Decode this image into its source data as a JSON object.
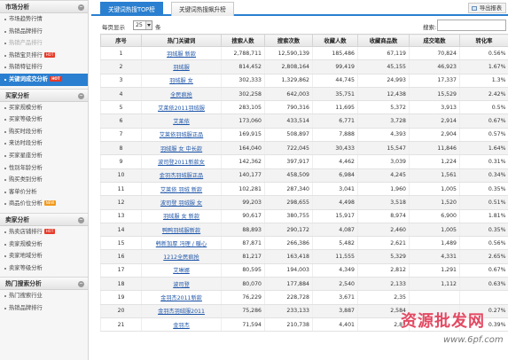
{
  "sidebar": {
    "sections": [
      {
        "title": "市场分析",
        "items": [
          {
            "label": "市场趋势行情",
            "style": "normal",
            "badge": ""
          },
          {
            "label": "热销品牌排行",
            "style": "normal",
            "badge": ""
          },
          {
            "label": "热销产品排行",
            "style": "gray",
            "badge": ""
          },
          {
            "label": "热销宝贝排行",
            "style": "normal",
            "badge": "HOT"
          },
          {
            "label": "热销特征排行",
            "style": "normal",
            "badge": ""
          },
          {
            "label": "关键词成交分析",
            "style": "active",
            "badge": "HOT"
          }
        ]
      },
      {
        "title": "买家分析",
        "items": [
          {
            "label": "买家规模分析",
            "style": "normal",
            "badge": ""
          },
          {
            "label": "买家等级分析",
            "style": "normal",
            "badge": ""
          },
          {
            "label": "购买时段分析",
            "style": "normal",
            "badge": ""
          },
          {
            "label": "来访时段分析",
            "style": "normal",
            "badge": ""
          },
          {
            "label": "买家星座分析",
            "style": "normal",
            "badge": ""
          },
          {
            "label": "性别年龄分析",
            "style": "normal",
            "badge": ""
          },
          {
            "label": "购买类别分析",
            "style": "normal",
            "badge": ""
          },
          {
            "label": "客单价分析",
            "style": "normal",
            "badge": ""
          },
          {
            "label": "商品价位分析",
            "style": "normal",
            "badge": "NEW"
          }
        ]
      },
      {
        "title": "卖家分析",
        "items": [
          {
            "label": "热卖店铺排行",
            "style": "normal",
            "badge": "HOT"
          },
          {
            "label": "卖家规模分析",
            "style": "normal",
            "badge": ""
          },
          {
            "label": "卖家地域分析",
            "style": "normal",
            "badge": ""
          },
          {
            "label": "卖家等级分析",
            "style": "normal",
            "badge": ""
          }
        ]
      },
      {
        "title": "热门搜索分析",
        "items": [
          {
            "label": "热门搜索行业",
            "style": "normal",
            "badge": ""
          },
          {
            "label": "热销品牌排行",
            "style": "normal",
            "badge": ""
          }
        ]
      }
    ]
  },
  "tabs": [
    {
      "label": "关键词热搜TOP榜",
      "active": true
    },
    {
      "label": "关键词热搜飙升榜",
      "active": false
    }
  ],
  "export_label": "导出报表",
  "toolbar": {
    "pagesize_prefix": "每页显示",
    "pagesize_value": "25",
    "pagesize_suffix": "条",
    "search_label": "搜索:",
    "search_value": ""
  },
  "table": {
    "columns": [
      "序号",
      "热门关键词",
      "搜索人数",
      "搜索次数",
      "收藏人数",
      "收藏商品数",
      "成交笔数",
      "转化率"
    ],
    "rows": [
      [
        "1",
        "羽绒服 新款",
        "2,788,711",
        "12,590,139",
        "185,486",
        "67,119",
        "70,824",
        "0.56%"
      ],
      [
        "2",
        "羽绒服",
        "814,452",
        "2,808,164",
        "99,419",
        "45,155",
        "46,923",
        "1.67%"
      ],
      [
        "3",
        "羽绒服 女",
        "302,333",
        "1,329,862",
        "44,745",
        "24,993",
        "17,337",
        "1.3%"
      ],
      [
        "4",
        "全民疯抢",
        "302,258",
        "642,003",
        "35,751",
        "12,438",
        "15,529",
        "2.42%"
      ],
      [
        "5",
        "艾莱依2011羽绒服",
        "283,105",
        "790,316",
        "11,695",
        "5,372",
        "3,913",
        "0.5%"
      ],
      [
        "6",
        "艾莱依",
        "173,060",
        "433,514",
        "6,771",
        "3,728",
        "2,914",
        "0.67%"
      ],
      [
        "7",
        "艾莱依羽绒服正品",
        "169,915",
        "508,897",
        "7,888",
        "4,393",
        "2,904",
        "0.57%"
      ],
      [
        "8",
        "羽绒服 女 中长款",
        "164,040",
        "722,045",
        "30,433",
        "15,547",
        "11,846",
        "1.64%"
      ],
      [
        "9",
        "波司登2011新款女",
        "142,362",
        "397,917",
        "4,462",
        "3,039",
        "1,224",
        "0.31%"
      ],
      [
        "10",
        "金羽杰羽绒服正品",
        "140,177",
        "458,509",
        "6,984",
        "4,245",
        "1,561",
        "0.34%"
      ],
      [
        "11",
        "艾莱依 羽绒 新款",
        "102,281",
        "287,340",
        "3,041",
        "1,960",
        "1,005",
        "0.35%"
      ],
      [
        "12",
        "波司登 羽绒服 女",
        "99,203",
        "298,655",
        "4,498",
        "3,518",
        "1,520",
        "0.51%"
      ],
      [
        "13",
        "羽绒服 女 新款",
        "90,617",
        "380,755",
        "15,917",
        "8,974",
        "6,900",
        "1.81%"
      ],
      [
        "14",
        "鸭鸭羽绒服新款",
        "88,893",
        "290,172",
        "4,087",
        "2,460",
        "1,005",
        "0.35%"
      ],
      [
        "15",
        "韩新加厚 冯理 / 暖心",
        "87,871",
        "266,386",
        "5,482",
        "2,621",
        "1,489",
        "0.56%"
      ],
      [
        "16",
        "1212全民疯抢",
        "81,217",
        "163,418",
        "11,555",
        "5,329",
        "4,331",
        "2.65%"
      ],
      [
        "17",
        "艾琳娜",
        "80,595",
        "194,003",
        "4,349",
        "2,812",
        "1,291",
        "0.67%"
      ],
      [
        "18",
        "波司登",
        "80,070",
        "177,884",
        "2,540",
        "2,133",
        "1,112",
        "0.63%"
      ],
      [
        "19",
        "金羽杰2011新款",
        "76,229",
        "228,728",
        "3,671",
        "2,35",
        "",
        ""
      ],
      [
        "20",
        "金羽杰羽绒服2011",
        "75,286",
        "233,133",
        "3,887",
        "2,584",
        "",
        "0.27%"
      ],
      [
        "21",
        "金羽杰",
        "71,594",
        "210,738",
        "4,401",
        "2,87",
        "",
        "0.39%"
      ]
    ]
  },
  "watermark": {
    "text": "资源批发网",
    "url": "www.6pf.com"
  },
  "colors": {
    "accent": "#2a7fd0",
    "link": "#1e55a8",
    "watermark": "#e24a63"
  }
}
